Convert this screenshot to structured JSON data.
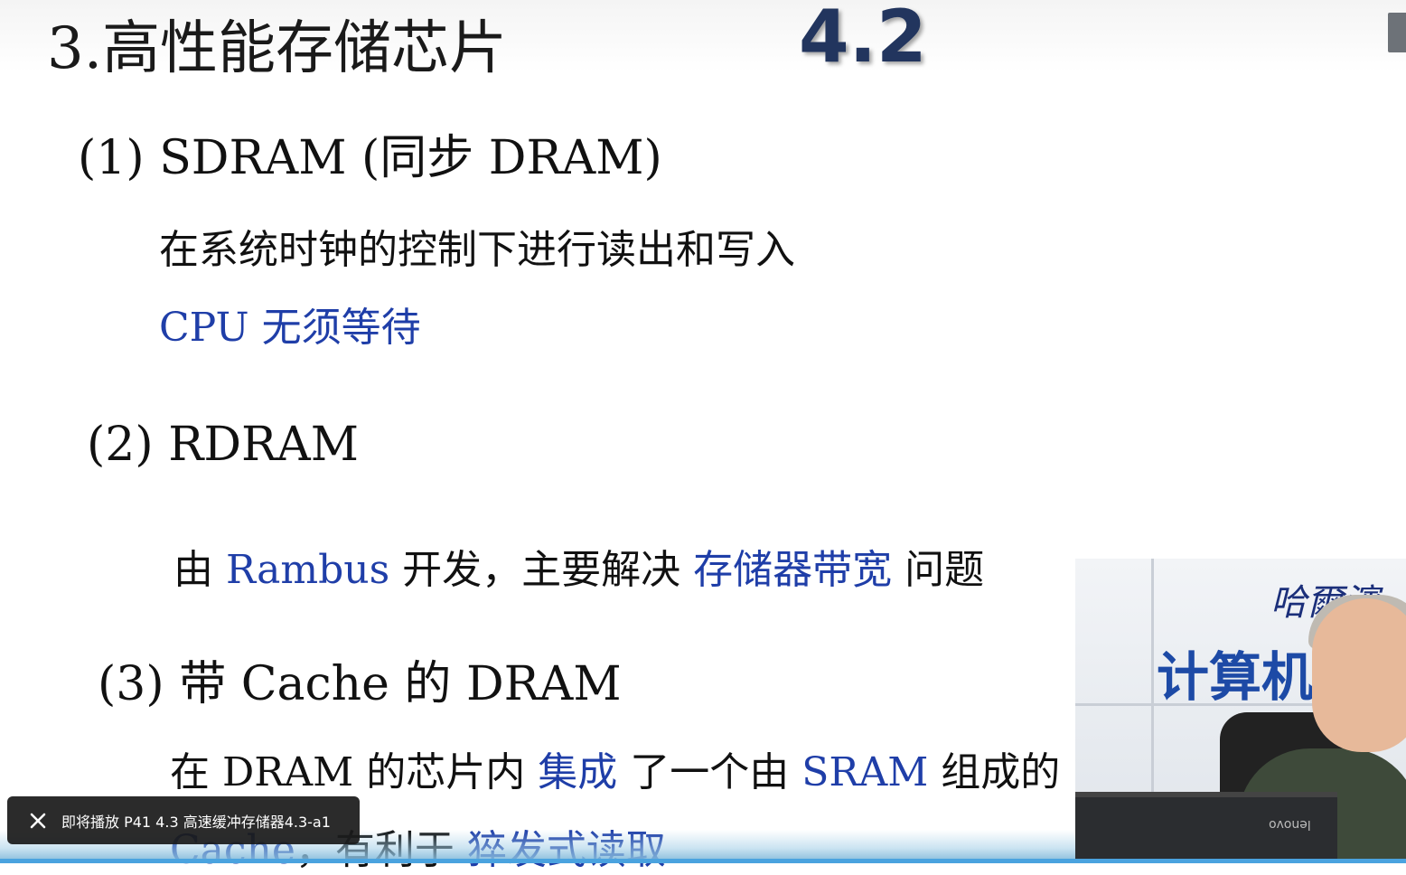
{
  "slide": {
    "title": "3.高性能存储芯片",
    "section_number": "4.2",
    "items": [
      {
        "heading": "(1) SDRAM (同步 DRAM)",
        "line1": "在系统时钟的控制下进行读出和写入",
        "line2": "CPU 无须等待"
      },
      {
        "heading": "(2) RDRAM",
        "line1_a": "由 ",
        "line1_b": "Rambus",
        "line1_c": " 开发，主要解决 ",
        "line1_d": "存储器带宽",
        "line1_e": " 问题"
      },
      {
        "heading": "(3) 带 Cache 的 DRAM",
        "line1_a": "在 DRAM 的芯片内 ",
        "line1_b": "集成",
        "line1_c": " 了一个由 ",
        "line1_d": "SRAM",
        "line1_e": " 组成的",
        "line2_a": "Cache",
        "line2_b": "，有利于 ",
        "line2_c": "猝发式读取"
      }
    ]
  },
  "presenter": {
    "wall_text_1": "哈爾濱",
    "wall_text_2": "计算机",
    "laptop_brand": "lenovo"
  },
  "upnext": {
    "label": "即将播放 P41 4.3 高速缓冲存储器4.3-a1"
  },
  "player": {
    "progress_fraction": 1.0
  },
  "colors": {
    "highlight_text": "#1f3ea8",
    "section_number": "#22355e",
    "toast_bg": "#191919"
  }
}
